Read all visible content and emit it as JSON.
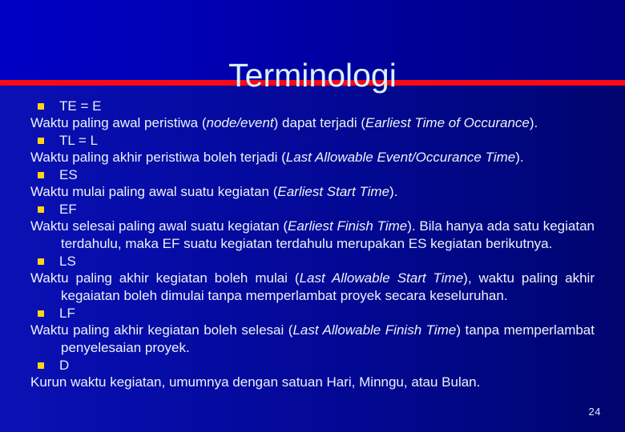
{
  "slide": {
    "title": "Terminologi",
    "page_number": "24",
    "accent_rule_color": "#fa0a14",
    "bullet_color": "#ffd417",
    "title_color": "#d6f2fb",
    "background_color": "#000080"
  },
  "terms": [
    {
      "bullet": "square-bullet",
      "label": "TE = E",
      "justified": false,
      "description": [
        {
          "text": "Waktu paling awal peristiwa (",
          "italic": false
        },
        {
          "text": "node/event",
          "italic": true
        },
        {
          "text": ") dapat terjadi (",
          "italic": false
        },
        {
          "text": "Earliest Time of Occurance",
          "italic": true
        },
        {
          "text": ").",
          "italic": false
        }
      ]
    },
    {
      "bullet": "square-bullet",
      "label": "TL = L",
      "justified": false,
      "description": [
        {
          "text": "Waktu paling akhir peristiwa boleh terjadi (",
          "italic": false
        },
        {
          "text": "Last Allowable Event/Occurance Time",
          "italic": true
        },
        {
          "text": ").",
          "italic": false
        }
      ]
    },
    {
      "bullet": "square-bullet",
      "label": "ES",
      "justified": false,
      "description": [
        {
          "text": "Waktu mulai paling awal suatu kegiatan (",
          "italic": false
        },
        {
          "text": "Earliest Start Time",
          "italic": true
        },
        {
          "text": ").",
          "italic": false
        }
      ]
    },
    {
      "bullet": "square-bullet",
      "label": "EF",
      "justified": true,
      "description": [
        {
          "text": "Waktu selesai paling awal suatu kegiatan (",
          "italic": false
        },
        {
          "text": "Earliest Finish Time",
          "italic": true
        },
        {
          "text": "). Bila hanya ada satu kegiatan terdahulu, maka EF suatu kegiatan terdahulu merupakan ES kegiatan berikutnya.",
          "italic": false
        }
      ]
    },
    {
      "bullet": "square-bullet",
      "label": "LS",
      "justified": true,
      "description": [
        {
          "text": "Waktu paling akhir kegiatan boleh mulai (",
          "italic": false
        },
        {
          "text": "Last Allowable Start Time",
          "italic": true
        },
        {
          "text": "), waktu paling akhir kegaiatan boleh dimulai tanpa memperlambat proyek secara keseluruhan.",
          "italic": false
        }
      ]
    },
    {
      "bullet": "square-bullet",
      "label": "LF",
      "justified": true,
      "description": [
        {
          "text": "Waktu paling akhir kegiatan boleh selesai (",
          "italic": false
        },
        {
          "text": "Last Allowable Finish Time",
          "italic": true
        },
        {
          "text": ") tanpa memperlambat penyelesaian proyek.",
          "italic": false
        }
      ]
    },
    {
      "bullet": "square-bullet",
      "label": "D",
      "justified": false,
      "description": [
        {
          "text": "Kurun waktu kegiatan, umumnya dengan satuan Hari, Minngu, atau Bulan.",
          "italic": false
        }
      ]
    }
  ]
}
